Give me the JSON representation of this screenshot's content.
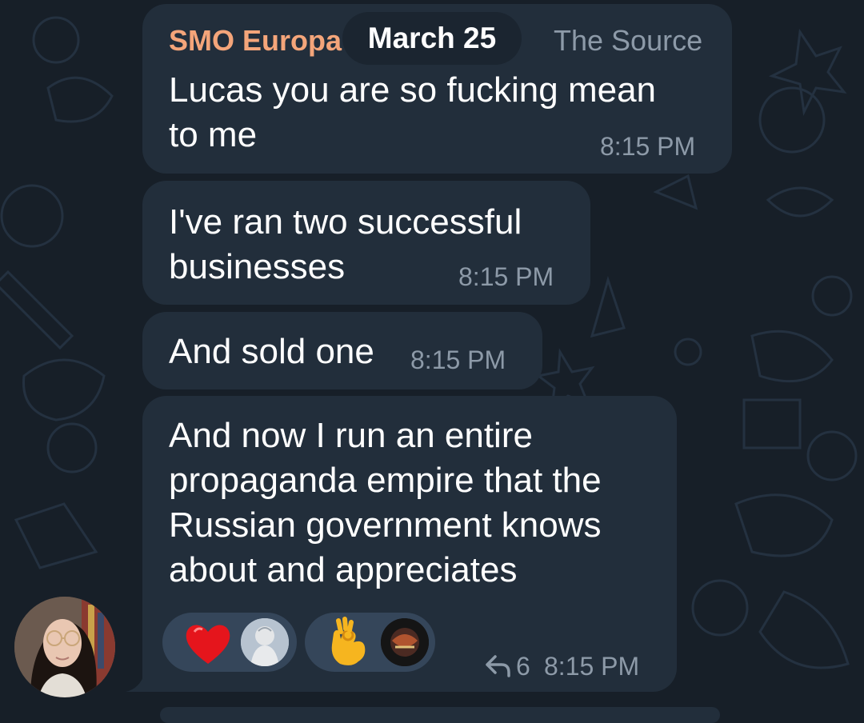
{
  "date_separator": "March 25",
  "messages": [
    {
      "sender": "SMO Europa",
      "admin_tag": "The Source",
      "text": "Lucas you are so fucking mean\nto me",
      "time": "8:15 PM"
    },
    {
      "text": "I've ran two successful\nbusinesses",
      "time": "8:15 PM"
    },
    {
      "text": "And sold one",
      "time": "8:15 PM"
    },
    {
      "text": "And now I run an entire\npropaganda empire that the\nRussian government knows\nabout and appreciates",
      "time": "8:15 PM",
      "forward_count": "6",
      "reactions": [
        {
          "emoji": "❤️",
          "icon": "red-heart-icon",
          "reactor": "statue-avatar"
        },
        {
          "emoji": "👌",
          "icon": "ok-hand-icon",
          "reactor": "dark-artwork-avatar"
        }
      ]
    }
  ],
  "colors": {
    "background": "#171f28",
    "bubble": "#222e3b",
    "sender_name": "#f4a57a",
    "meta_text": "#8d9aa8",
    "reaction_pill": "#35465a"
  }
}
